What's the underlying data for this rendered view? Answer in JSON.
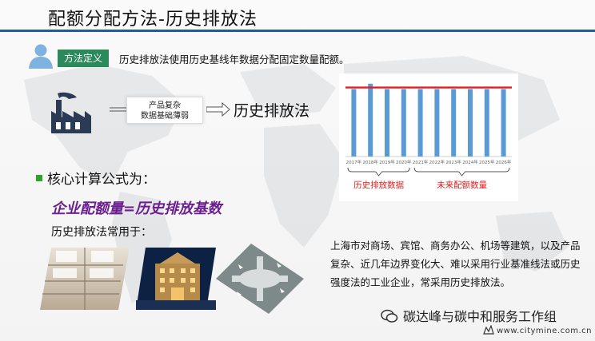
{
  "title": "配额分配方法-历史排放法",
  "definition": {
    "tag": "方法定义",
    "text": "历史排放法使用历史基线年数据分配固定数量配额。"
  },
  "flow": {
    "box_line1": "产品复杂",
    "box_line2": "数据基础薄弱",
    "method": "历史排放法"
  },
  "chart_data": {
    "type": "bar",
    "categories": [
      "2017年",
      "2018年",
      "2019年",
      "2020年",
      "2021年",
      "2022年",
      "2023年",
      "2024年",
      "2025年",
      "2026年"
    ],
    "values": [
      88,
      95,
      88,
      88,
      88,
      88,
      88,
      88,
      88,
      88
    ],
    "ylim": [
      0,
      100
    ],
    "reference_line": 90,
    "bar_color": "#5b9bd5",
    "line_color": "#e02020",
    "groups": [
      {
        "label": "历史排放数据",
        "range": [
          0,
          3
        ]
      },
      {
        "label": "未来配额数量",
        "range": [
          4,
          9
        ]
      }
    ],
    "group_label_color": "#e02020"
  },
  "formula": {
    "heading": "核心计算公式为：",
    "expression": "企业配额量=历史排放基数"
  },
  "usage": {
    "heading": "历史排放法常用于：",
    "photos": [
      "mall-interior",
      "hotel-exterior",
      "airport-aerial"
    ]
  },
  "description": "上海市对商场、宾馆、商务办公、机场等建筑，以及产品复杂、近几年边界变化大、难以采用行业基准线法或历史强度法的工业企业，常采用历史排放法。",
  "footer": {
    "wechat": "碳达峰与碳中和服务工作组",
    "site": "www.citymine.com.cn"
  },
  "colors": {
    "header_line": "#1f5e99",
    "tag_bg": "#2a8a5c",
    "formula": "#6b1f8f"
  }
}
